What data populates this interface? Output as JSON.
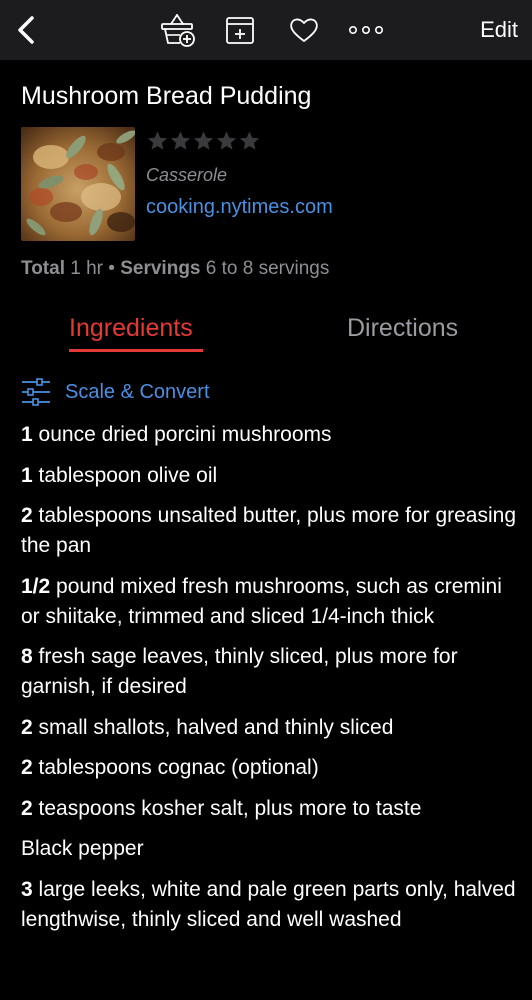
{
  "toolbar": {
    "back_icon": "chevron-left-icon",
    "basket_icon": "basket-add-icon",
    "box_icon": "add-to-box-icon",
    "heart_icon": "heart-icon",
    "more_icon": "more-dots-icon",
    "edit_label": "Edit"
  },
  "recipe": {
    "title": "Mushroom Bread Pudding",
    "rating": 0,
    "rating_max": 5,
    "category": "Casserole",
    "source": "cooking.nytimes.com",
    "meta": {
      "total_label": "Total",
      "total_value": "1 hr",
      "separator": "•",
      "servings_label": "Servings",
      "servings_value": "6 to 8 servings"
    }
  },
  "tabs": {
    "ingredients": "Ingredients",
    "directions": "Directions"
  },
  "scale": {
    "label": "Scale & Convert",
    "icon": "sliders-icon"
  },
  "ingredients": [
    {
      "qty": "1",
      "text": "ounce dried porcini mushrooms"
    },
    {
      "qty": "1",
      "text": "tablespoon olive oil"
    },
    {
      "qty": "2",
      "text": "tablespoons unsalted butter, plus more for greasing the pan"
    },
    {
      "qty": "1/2",
      "text": "pound mixed fresh mushrooms, such as cremini or shiitake, trimmed and sliced 1/4-inch thick"
    },
    {
      "qty": "8",
      "text": "fresh sage leaves, thinly sliced, plus more for garnish, if desired"
    },
    {
      "qty": "2",
      "text": "small shallots, halved and thinly sliced"
    },
    {
      "qty": "2",
      "text": "tablespoons cognac (optional)"
    },
    {
      "qty": "2",
      "text": "teaspoons kosher salt, plus more to taste"
    },
    {
      "qty": "",
      "text": "Black pepper"
    },
    {
      "qty": "3",
      "text": "large leeks, white and pale green parts only, halved lengthwise, thinly sliced and well washed"
    }
  ],
  "colors": {
    "background": "#000000",
    "toolbar": "#1c1c1e",
    "accent_red": "#e53935",
    "link_blue": "#4a90e2",
    "muted_gray": "#8e8e93",
    "star_gray": "#3a3a3c"
  }
}
